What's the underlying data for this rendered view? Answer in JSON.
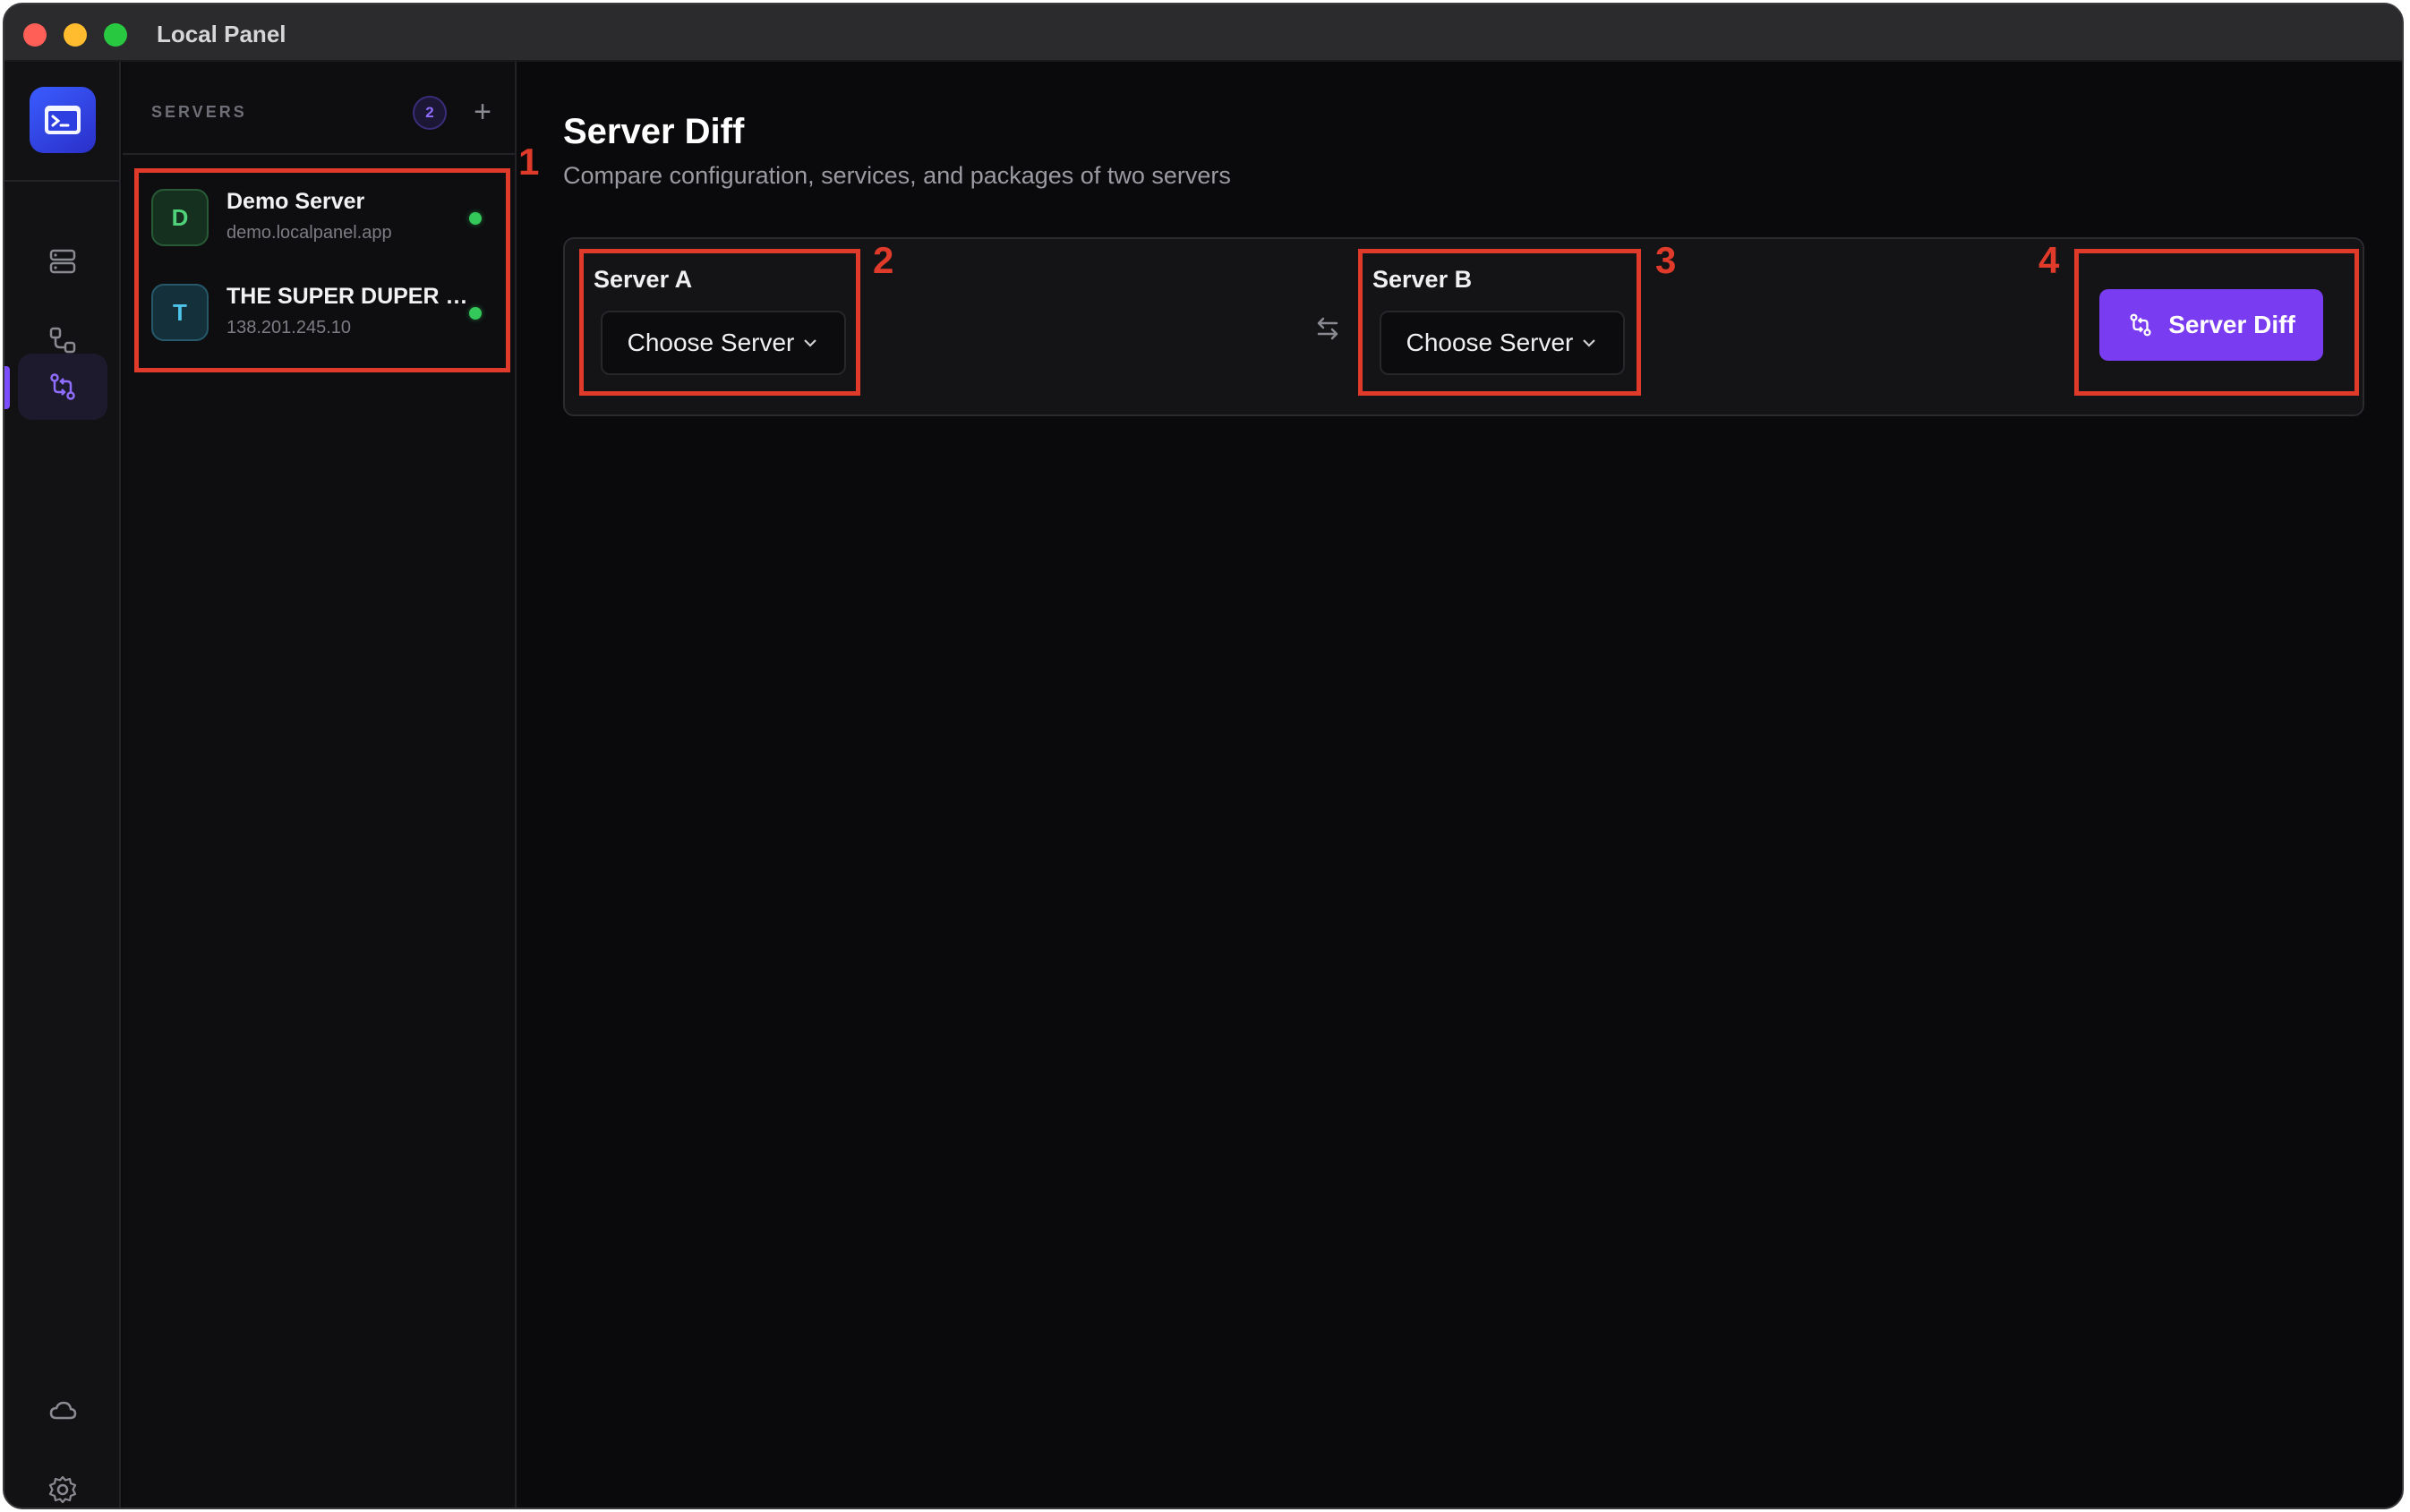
{
  "window": {
    "title": "Local Panel"
  },
  "rail": {
    "items": [
      {
        "icon": "servers-icon"
      },
      {
        "icon": "connections-icon"
      },
      {
        "icon": "diff-icon",
        "active": true
      }
    ],
    "bottom": [
      {
        "icon": "cloud-icon"
      },
      {
        "icon": "gear-icon"
      }
    ]
  },
  "servers": {
    "label": "SERVERS",
    "count": "2",
    "add_label": "+",
    "items": [
      {
        "initial": "D",
        "name": "Demo Server",
        "host": "demo.localpanel.app",
        "status": "online"
      },
      {
        "initial": "T",
        "name": "THE SUPER DUPER …",
        "host": "138.201.245.10",
        "status": "online"
      }
    ]
  },
  "main": {
    "title": "Server Diff",
    "subtitle": "Compare configuration, services, and packages of two servers",
    "server_a": {
      "label": "Server A",
      "placeholder": "Choose Server"
    },
    "server_b": {
      "label": "Server B",
      "placeholder": "Choose Server"
    },
    "diff_button": "Server Diff"
  },
  "annotations": [
    "1",
    "2",
    "3",
    "4"
  ],
  "colors": {
    "accent": "#7a3cf0",
    "annotation": "#e03a2a",
    "status_online": "#34c759"
  }
}
